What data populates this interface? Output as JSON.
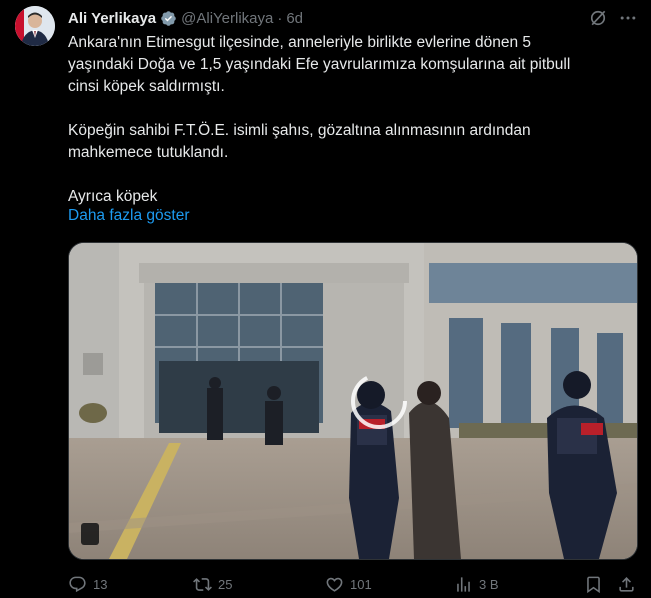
{
  "author": {
    "name": "Ali Yerlikaya",
    "handle": "@AliYerlikaya",
    "time": "6d"
  },
  "tweet": {
    "p1": [
      "Ankara'nın Etimesgut ilçesinde, anneleriyle birlikte evlerine dönen 5",
      "yaşındaki Doğa ve 1,5 yaşındaki Efe yavrularımıza komşularına ait pitbull",
      "cinsi köpek saldırmıştı."
    ],
    "p2": [
      "Köpeğin sahibi F.T.Ö.E. isimli şahıs, gözaltına alınmasının ardından",
      "mahkemece tutuklandı."
    ],
    "p3": [
      "Ayrıca köpek"
    ],
    "show_more": "Daha fazla göster"
  },
  "actions": {
    "replies": "13",
    "retweets": "25",
    "likes": "101",
    "views": "3 B"
  },
  "colors": {
    "background": "#000000",
    "text": "#e7e9ea",
    "muted": "#71767b",
    "accent": "#1d9bf0"
  },
  "icons": [
    "verified-badge-icon",
    "grok-icon",
    "more-icon",
    "reply-icon",
    "retweet-icon",
    "like-icon",
    "views-icon",
    "bookmark-icon",
    "share-icon",
    "video-loading-spinner"
  ]
}
